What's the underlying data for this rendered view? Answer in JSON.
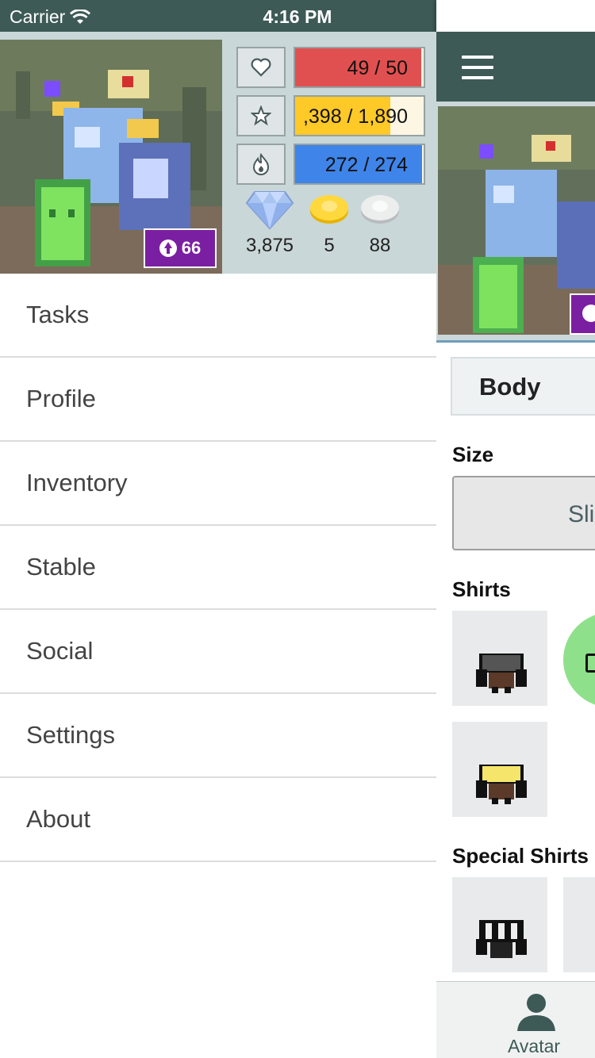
{
  "status_bar": {
    "carrier": "Carrier",
    "time": "4:16 PM"
  },
  "drawer": {
    "level": "66",
    "stats": [
      {
        "icon": "heart-icon",
        "value": "49 / 50",
        "fill_fraction": 0.98,
        "color": "#e15050"
      },
      {
        "icon": "star-icon",
        "value": ",398 / 1,890",
        "fill_fraction": 0.74,
        "color": "#ffc928"
      },
      {
        "icon": "fire-icon",
        "value": "272 / 274",
        "fill_fraction": 0.99,
        "color": "#3f84e8"
      }
    ],
    "currencies": [
      {
        "icon": "gem-icon",
        "value": "3,875"
      },
      {
        "icon": "gold-coin-icon",
        "value": "5"
      },
      {
        "icon": "silver-coin-icon",
        "value": "88"
      }
    ],
    "menu": [
      "Tasks",
      "Profile",
      "Inventory",
      "Stable",
      "Social",
      "Settings",
      "About"
    ]
  },
  "main": {
    "segment_label": "Body",
    "size_title": "Size",
    "size_option": "Sli",
    "shirts_title": "Shirts",
    "special_shirts_title": "Special Shirts",
    "tab_label": "Avatar"
  },
  "colors": {
    "header": "#3d5a56",
    "drawer_header": "#cad7d8",
    "level_badge": "#7b1fa2"
  }
}
